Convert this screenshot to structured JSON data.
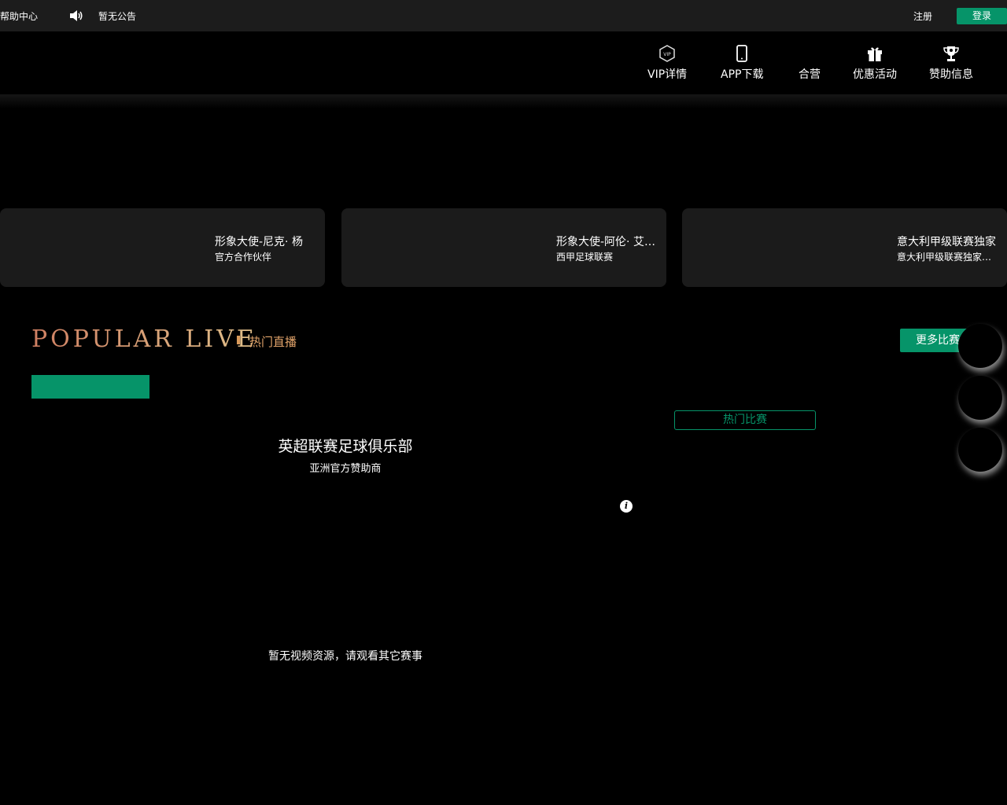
{
  "topbar": {
    "help": "帮助中心",
    "notice": "暂无公告",
    "register": "注册",
    "login": "登录"
  },
  "nav": {
    "items": [
      {
        "label": "VIP详情",
        "icon": "vip-icon"
      },
      {
        "label": "APP下载",
        "icon": "phone-icon"
      },
      {
        "label": "合营",
        "icon": ""
      },
      {
        "label": "优惠活动",
        "icon": "gift-icon"
      },
      {
        "label": "赞助信息",
        "icon": "trophy-icon"
      }
    ]
  },
  "cards": [
    {
      "title": "形象大使-尼克· 杨",
      "subtitle": "官方合作伙伴"
    },
    {
      "title": "形象大使-阿伦· 艾弗森",
      "subtitle": "西甲足球联赛"
    },
    {
      "title": "意大利甲级联赛独家",
      "subtitle": "意大利甲级联赛独家合作"
    }
  ],
  "popular": {
    "title_en": "POPULAR LIVE",
    "title_cn": "热门直播",
    "more": "更多比赛",
    "hot_match": "热门比赛",
    "club_title": "英超联赛足球俱乐部",
    "club_sub": "亚洲官方赞助商",
    "no_video": "暂无视频资源，请观看其它赛事"
  },
  "colors": {
    "accent": "#069469",
    "gold": "#e3a56b",
    "topbar_bg": "#1c1c1c",
    "card_bg": "#1b1b1b"
  }
}
